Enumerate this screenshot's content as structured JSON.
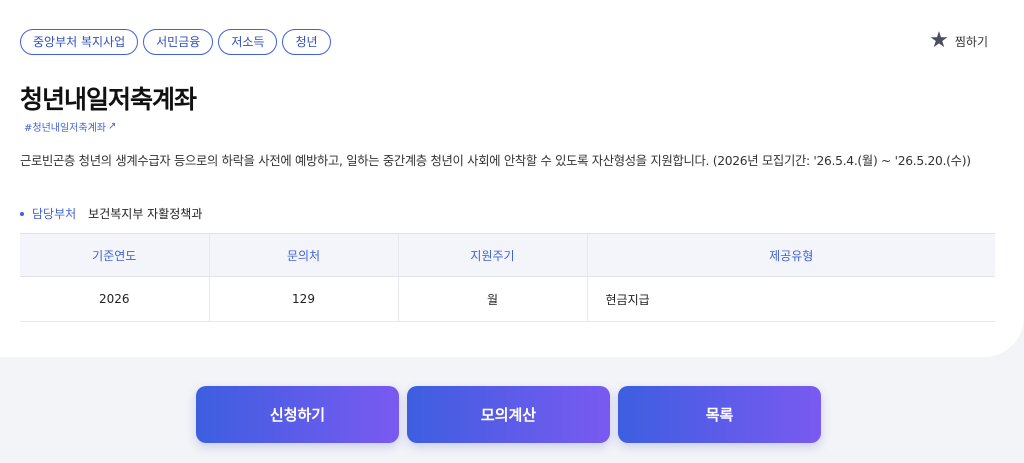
{
  "tags": [
    "중앙부처 복지사업",
    "서민금융",
    "저소득",
    "청년"
  ],
  "favorite": {
    "icon": "star-icon",
    "label": "찜하기"
  },
  "title": "청년내일저축계좌",
  "hashtag": {
    "label": "#청년내일저축계좌",
    "icon": "external-link-icon"
  },
  "description": "근로빈곤층 청년의 생계수급자 등으로의 하락을 사전에 예방하고, 일하는 중간계층 청년이 사회에 안착할 수 있도록 자산형성을 지원합니다. (2026년 모집기간: '26.5.4.(월) ~ '26.5.20.(수))",
  "department": {
    "label": "담당부처",
    "value": "보건복지부 자활정책과"
  },
  "table": {
    "headers": [
      "기준연도",
      "문의처",
      "지원주기",
      "제공유형"
    ],
    "row": [
      "2026",
      "129",
      "월",
      "현금지급"
    ]
  },
  "buttons": {
    "apply": "신청하기",
    "simulate": "모의계산",
    "list": "목록"
  },
  "colors": {
    "accent": "#3f63d6",
    "gradient_start": "#3d5ee0",
    "gradient_end": "#7a5af0"
  }
}
